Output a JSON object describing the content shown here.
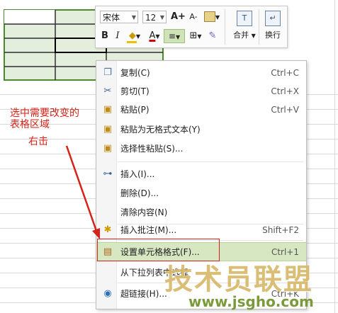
{
  "mini_toolbar": {
    "font_name": "宋体",
    "font_size": "12",
    "grow_font": "A+",
    "shrink_font": "A-",
    "bold": "B",
    "italic": "I",
    "font_color_letter": "A",
    "merge_label": "合并",
    "wrap_label": "换行"
  },
  "context_menu": {
    "items": [
      {
        "label": "复制(C)",
        "shortcut": "Ctrl+C",
        "icon": "copy-icon"
      },
      {
        "label": "剪切(T)",
        "shortcut": "Ctrl+X",
        "icon": "cut-icon"
      },
      {
        "label": "粘贴(P)",
        "shortcut": "Ctrl+V",
        "icon": "paste-icon"
      },
      {
        "label": "粘贴为无格式文本(Y)",
        "shortcut": "",
        "icon": "paste-text-icon"
      },
      {
        "label": "选择性粘贴(S)...",
        "shortcut": "",
        "icon": "paste-special-icon"
      },
      {
        "label": "插入(I)...",
        "shortcut": "",
        "icon": "insert-icon"
      },
      {
        "label": "删除(D)...",
        "shortcut": "",
        "icon": ""
      },
      {
        "label": "清除内容(N)",
        "shortcut": "",
        "icon": ""
      },
      {
        "label": "插入批注(M)...",
        "shortcut": "Shift+F2",
        "icon": "comment-icon"
      },
      {
        "label": "设置单元格格式(F)...",
        "shortcut": "Ctrl+1",
        "icon": "format-cells-icon"
      },
      {
        "label": "从下拉列表中选择",
        "shortcut": "",
        "icon": ""
      },
      {
        "label": "超链接(H)...",
        "shortcut": "Ctrl+K",
        "icon": "hyperlink-icon"
      }
    ]
  },
  "annotations": {
    "instruction_line1": "选中需要改变的",
    "instruction_line2": "表格区域",
    "right_click": "右击"
  },
  "watermark": {
    "text": "技术员联盟",
    "url": "www.jsgho.com"
  },
  "colors": {
    "selection_green": "#4e8a2e",
    "highlight_bg": "#d6e7c2",
    "annotation_red": "#d62218"
  }
}
